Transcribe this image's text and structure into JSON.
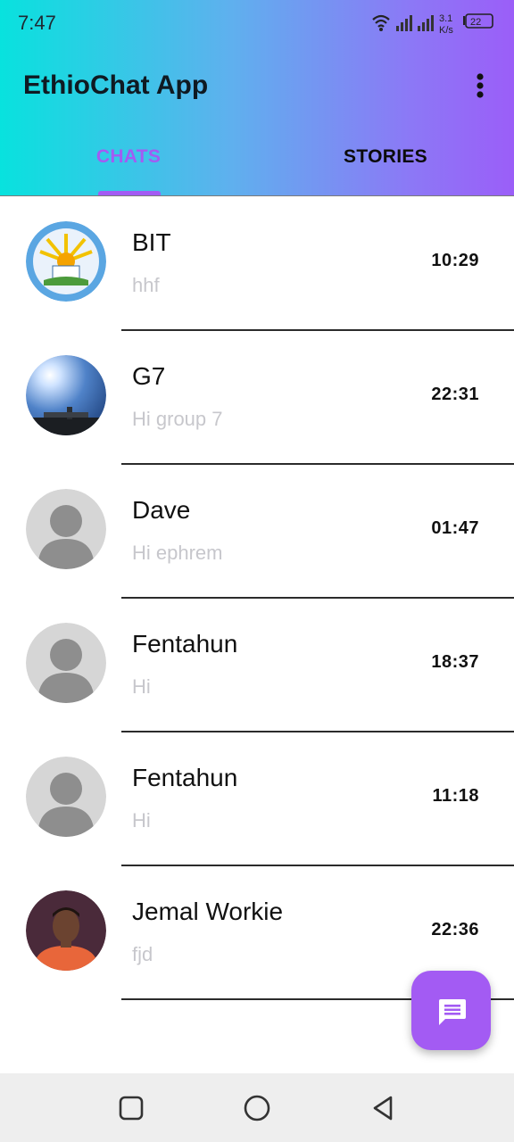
{
  "status_bar": {
    "time": "7:47",
    "net_speed_value": "3.1",
    "net_speed_unit": "K/s",
    "battery": "22"
  },
  "app_bar": {
    "title": "EthioChat App",
    "menu_icon": "more-vert-icon"
  },
  "tabs": [
    {
      "label": "CHATS",
      "active": true
    },
    {
      "label": "STORIES",
      "active": false
    }
  ],
  "chats": [
    {
      "name": "BIT",
      "preview": "hhf",
      "time": "10:29",
      "avatar": "bit-logo"
    },
    {
      "name": "G7",
      "preview": "Hi group 7",
      "time": "22:31",
      "avatar": "sky-photo"
    },
    {
      "name": "Dave",
      "preview": "Hi ephrem",
      "time": "01:47",
      "avatar": "default-person"
    },
    {
      "name": "Fentahun",
      "preview": "Hi",
      "time": "18:37",
      "avatar": "default-person"
    },
    {
      "name": "Fentahun",
      "preview": "Hi",
      "time": "11:18",
      "avatar": "default-person"
    },
    {
      "name": "Jemal Workie",
      "preview": "fjd",
      "time": "22:36",
      "avatar": "person-photo"
    }
  ],
  "fab": {
    "icon": "message-icon"
  },
  "colors": {
    "accent": "#a35bf3",
    "gradient_start": "#08e2de",
    "gradient_end": "#9b5ef8"
  },
  "nav_bar": [
    "recents-square-icon",
    "home-circle-icon",
    "back-triangle-icon"
  ]
}
